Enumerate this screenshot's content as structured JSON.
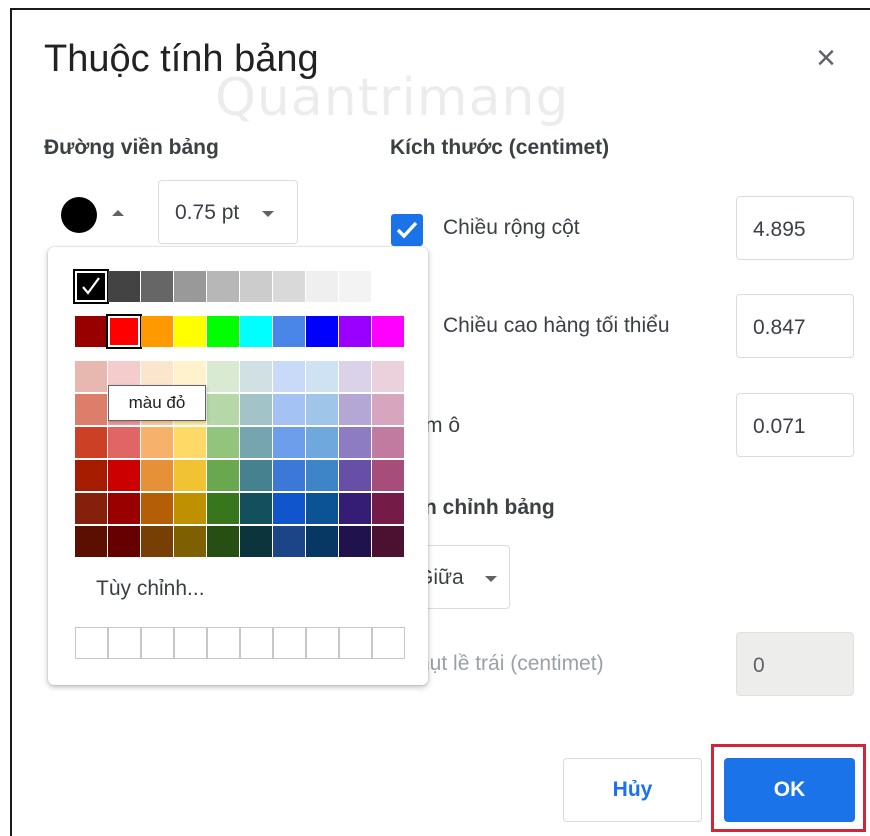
{
  "dialog": {
    "title": "Thuộc tính bảng",
    "close_glyph": "×",
    "watermark": "Quantrimang"
  },
  "border": {
    "section_label": "Đường viền bảng",
    "color_swatch": "#000000",
    "width_value": "0.75 pt"
  },
  "size": {
    "section_label": "Kích thước  (centimet)",
    "column_width_label": "Chiều rộng cột",
    "column_width_checked": true,
    "column_width_value": "4.895",
    "min_row_height_label": "Chiều cao hàng tối thiểu",
    "min_row_height_value": "0.847",
    "cell_padding_label_partial": "m ô",
    "cell_padding_value": "0.071"
  },
  "alignment": {
    "section_label_partial": "n chỉnh bảng",
    "align_value_partial": "Giữa",
    "indent_label_partial": "hụt lề trái  (centimet)",
    "indent_value": "0"
  },
  "palette": {
    "custom_label": "Tùy chỉnh...",
    "tooltip": "màu đỏ",
    "selected_color": "#000000",
    "hovered_color": "#ff0000",
    "greys": [
      "#000000",
      "#434343",
      "#666666",
      "#999999",
      "#b7b7b7",
      "#cccccc",
      "#d9d9d9",
      "#efefef",
      "#f3f3f3",
      "#ffffff"
    ],
    "main": [
      "#980000",
      "#ff0000",
      "#ff9900",
      "#ffff00",
      "#00ff00",
      "#00ffff",
      "#4a86e8",
      "#0000ff",
      "#9900ff",
      "#ff00ff"
    ],
    "shades": [
      [
        "#e6b8af",
        "#f4cccc",
        "#fce5cd",
        "#fff2cc",
        "#d9ead3",
        "#d0e0e3",
        "#c9daf8",
        "#cfe2f3",
        "#d9d2e9",
        "#ead1dc"
      ],
      [
        "#dd7e6b",
        "#ea9999",
        "#f9cb9c",
        "#ffe599",
        "#b6d7a8",
        "#a2c4c9",
        "#a4c2f4",
        "#9fc5e8",
        "#b4a7d6",
        "#d5a6bd"
      ],
      [
        "#cc4125",
        "#e06666",
        "#f6b26b",
        "#ffd966",
        "#93c47d",
        "#76a5af",
        "#6d9eeb",
        "#6fa8dc",
        "#8e7cc3",
        "#c27ba0"
      ],
      [
        "#a61c00",
        "#cc0000",
        "#e69138",
        "#f1c232",
        "#6aa84f",
        "#45818e",
        "#3c78d8",
        "#3d85c6",
        "#674ea7",
        "#a64d79"
      ],
      [
        "#85200c",
        "#990000",
        "#b45f06",
        "#bf9000",
        "#38761d",
        "#134f5c",
        "#1155cc",
        "#0b5394",
        "#351c75",
        "#741b47"
      ],
      [
        "#5b0f00",
        "#660000",
        "#783f04",
        "#7f6000",
        "#274e13",
        "#0c343d",
        "#1c4587",
        "#073763",
        "#20124d",
        "#4c1130"
      ]
    ],
    "custom_slots": 10
  },
  "buttons": {
    "cancel_label": "Hủy",
    "ok_label": "OK"
  },
  "colors": {
    "accent": "#1a73e8",
    "highlight": "#d0263a"
  }
}
